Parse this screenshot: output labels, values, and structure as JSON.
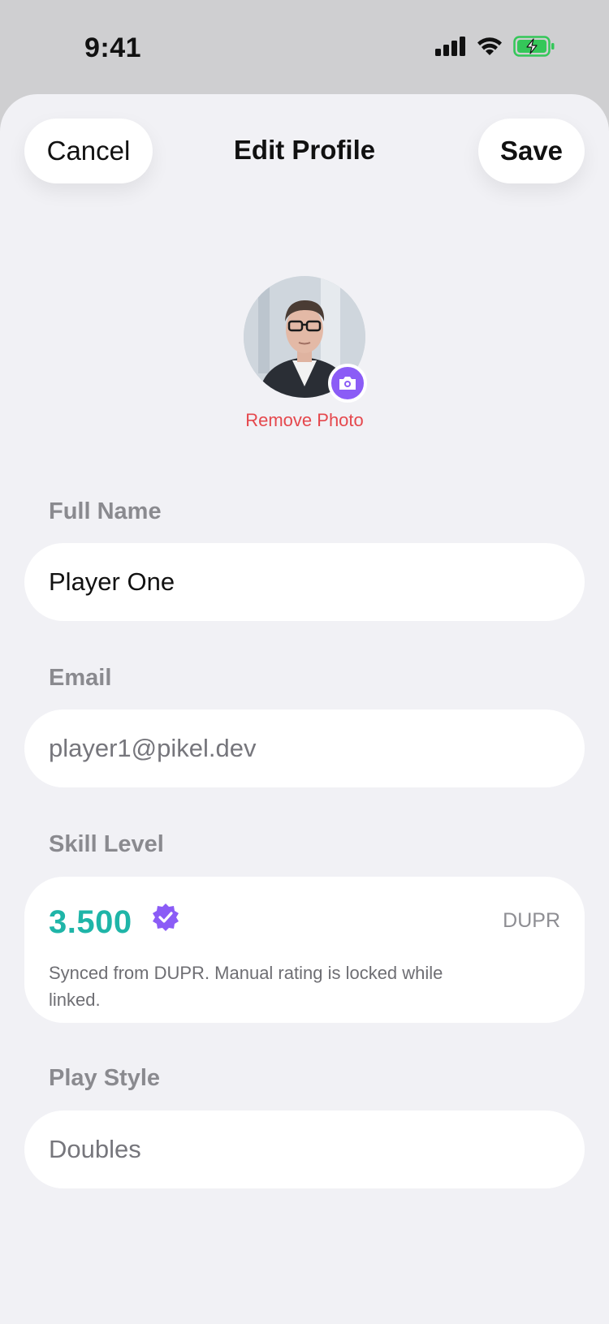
{
  "status_bar": {
    "time": "9:41"
  },
  "header": {
    "cancel_label": "Cancel",
    "title": "Edit Profile",
    "save_label": "Save"
  },
  "profile_photo": {
    "remove_label": "Remove Photo"
  },
  "form": {
    "full_name": {
      "label": "Full Name",
      "value": "Player One"
    },
    "email": {
      "label": "Email",
      "value": "player1@pikel.dev"
    },
    "skill_level": {
      "label": "Skill Level",
      "value": "3.500",
      "source": "DUPR",
      "note": "Synced from DUPR. Manual rating is locked while linked."
    },
    "play_style": {
      "label": "Play Style",
      "value": "Doubles"
    }
  },
  "colors": {
    "accent_purple": "#8b5cf6",
    "skill_teal": "#1fb5a8",
    "destructive_red": "#e5484d",
    "battery_green": "#34c759"
  },
  "icons": [
    "signal-icon",
    "wifi-icon",
    "battery-charging-icon",
    "camera-icon",
    "verified-badge-icon"
  ]
}
